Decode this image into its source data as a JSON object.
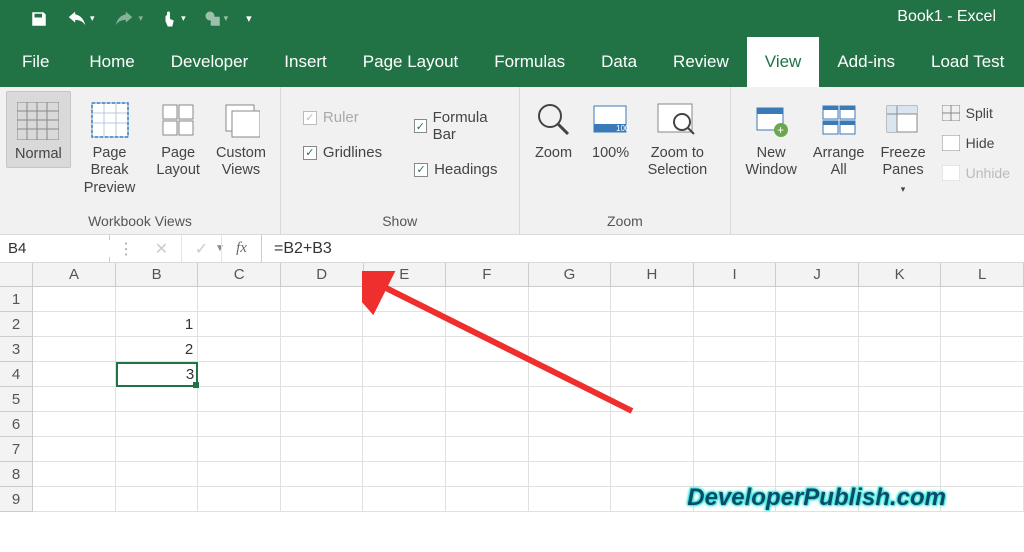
{
  "app": {
    "title": "Book1 - Excel"
  },
  "qat": {
    "save": "Save",
    "undo": "Undo",
    "redo": "Redo",
    "touch": "Touch",
    "share": "Share"
  },
  "tabs": {
    "file": "File",
    "home": "Home",
    "developer": "Developer",
    "insert": "Insert",
    "pagelayout": "Page Layout",
    "formulas": "Formulas",
    "data": "Data",
    "review": "Review",
    "view": "View",
    "addins": "Add-ins",
    "loadtest": "Load Test"
  },
  "ribbon": {
    "views": {
      "normal": "Normal",
      "pagebreak": "Page Break\nPreview",
      "pagelayout": "Page\nLayout",
      "custom": "Custom\nViews",
      "group": "Workbook Views"
    },
    "show": {
      "ruler": "Ruler",
      "gridlines": "Gridlines",
      "formulabar": "Formula Bar",
      "headings": "Headings",
      "group": "Show"
    },
    "zoom": {
      "zoom": "Zoom",
      "hundred": "100%",
      "selection": "Zoom to\nSelection",
      "group": "Zoom"
    },
    "window": {
      "new": "New\nWindow",
      "arrange": "Arrange\nAll",
      "freeze": "Freeze\nPanes",
      "split": "Split",
      "hide": "Hide",
      "unhide": "Unhide"
    }
  },
  "fbar": {
    "name": "B4",
    "formula": "=B2+B3"
  },
  "grid": {
    "columns": [
      "A",
      "B",
      "C",
      "D",
      "E",
      "F",
      "G",
      "H",
      "I",
      "J",
      "K",
      "L"
    ],
    "rows": [
      "1",
      "2",
      "3",
      "4",
      "5",
      "6",
      "7",
      "8",
      "9"
    ],
    "cells": {
      "B2": "1",
      "B3": "2",
      "B4": "3"
    },
    "selected": "B4"
  },
  "watermark": "DeveloperPublish.com"
}
